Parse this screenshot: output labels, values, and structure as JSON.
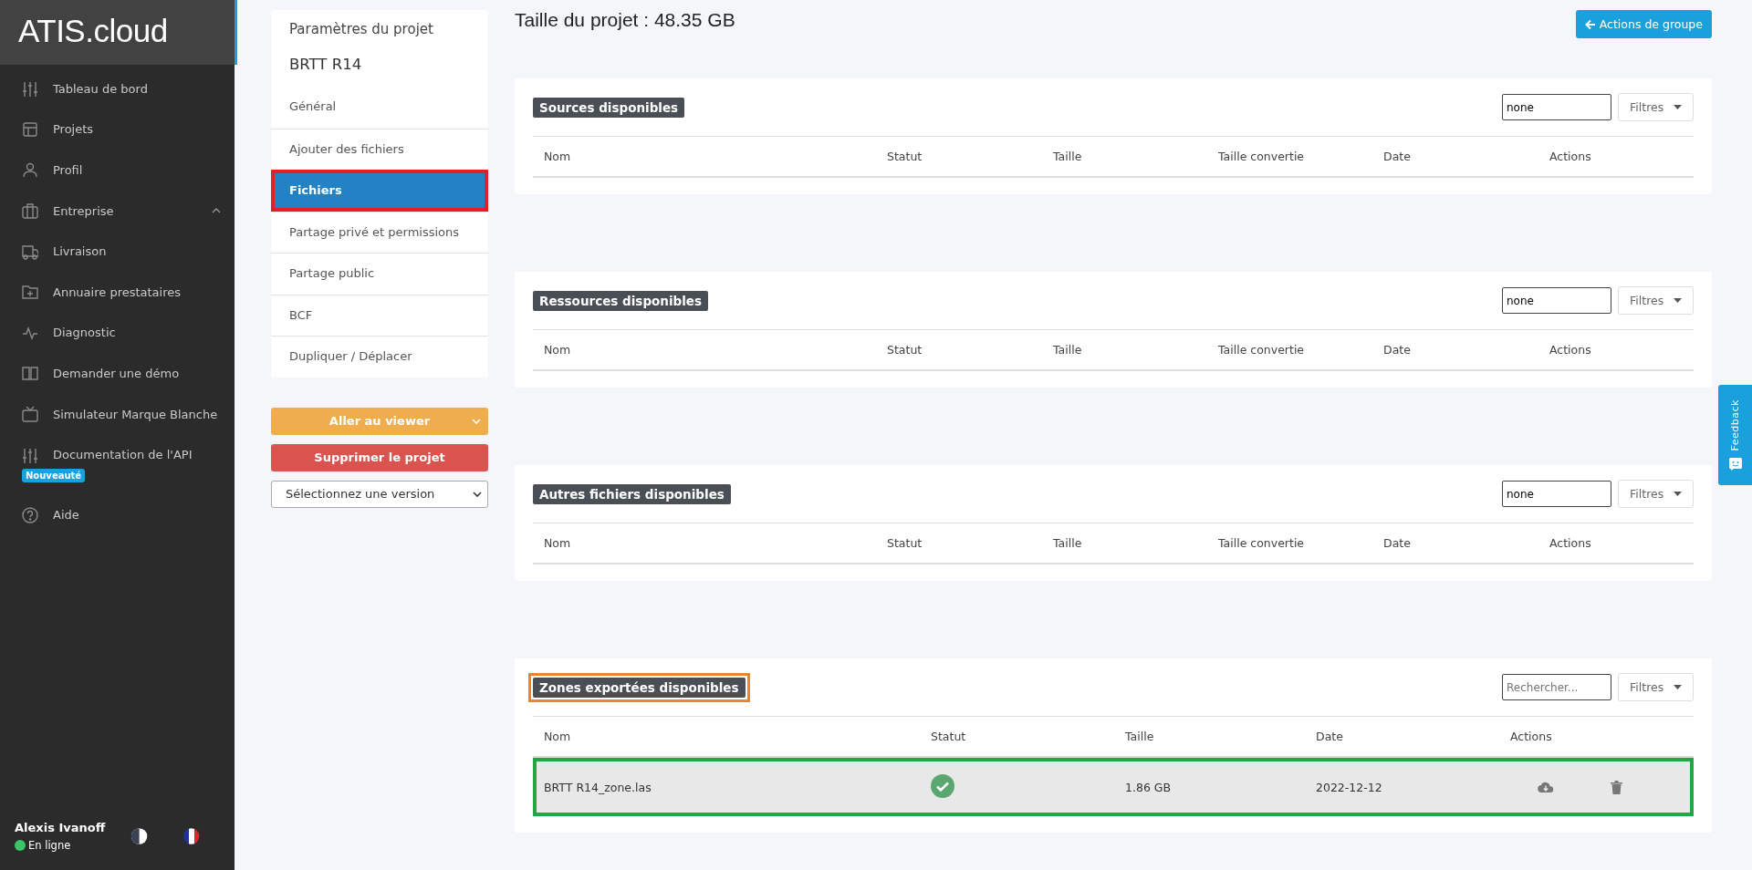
{
  "sidebar": {
    "logo": "ATIS.cloud",
    "items": [
      {
        "label": "Tableau de bord"
      },
      {
        "label": "Projets"
      },
      {
        "label": "Profil"
      },
      {
        "label": "Entreprise",
        "expanded": true
      },
      {
        "label": "Livraison"
      },
      {
        "label": "Annuaire prestataires"
      },
      {
        "label": "Diagnostic"
      },
      {
        "label": "Demander une démo"
      },
      {
        "label": "Simulateur Marque Blanche"
      },
      {
        "label": "Documentation de l'API",
        "badge": "Nouveauté"
      },
      {
        "label": "Aide"
      }
    ],
    "user": {
      "name": "Alexis Ivanoff",
      "status": "En ligne",
      "online": true
    }
  },
  "settings": {
    "title": "Paramètres du projet",
    "project": "BRTT R14",
    "items": [
      {
        "label": "Général",
        "selected": false
      },
      {
        "label": "Ajouter des fichiers",
        "selected": false
      },
      {
        "label": "Fichiers",
        "selected": true,
        "color": "#e0202a"
      },
      {
        "label": "Partage privé et permissions",
        "selected": false
      },
      {
        "label": "Partage public",
        "selected": false
      },
      {
        "label": "BCF",
        "selected": false
      },
      {
        "label": "Dupliquer / Déplacer",
        "selected": false
      }
    ],
    "viewer_button": "Aller au viewer",
    "delete_button": "Supprimer le projet",
    "version_select": "Sélectionnez une version"
  },
  "main": {
    "title": "Taille du projet : 48.35 GB",
    "group_button": "Actions de groupe",
    "panels": [
      {
        "title": "Sources disponibles",
        "search_value": "none",
        "filter": "Filtres",
        "columns": [
          "Nom",
          "Statut",
          "Taille",
          "Taille convertie",
          "Date",
          "Actions"
        ]
      },
      {
        "title": "Ressources disponibles",
        "search_value": "none",
        "filter": "Filtres",
        "columns": [
          "Nom",
          "Statut",
          "Taille",
          "Taille convertie",
          "Date",
          "Actions"
        ]
      },
      {
        "title": "Autres fichiers disponibles",
        "search_value": "none",
        "filter": "Filtres",
        "columns": [
          "Nom",
          "Statut",
          "Taille",
          "Taille convertie",
          "Date",
          "Actions"
        ]
      },
      {
        "title": "Zones exportées disponibles",
        "color": "#f0822a",
        "search_placeholder": "Rechercher...",
        "filter": "Filtres",
        "columns": [
          "Nom",
          "Statut",
          "Taille",
          "Date",
          "Actions"
        ],
        "rows": [
          {
            "name": "BRTT R14_zone.las",
            "status_ok": true,
            "size": "1.86 GB",
            "date": "2022-12-12",
            "color": "#22a744"
          }
        ]
      }
    ]
  },
  "feedback_tab": "Feedback"
}
